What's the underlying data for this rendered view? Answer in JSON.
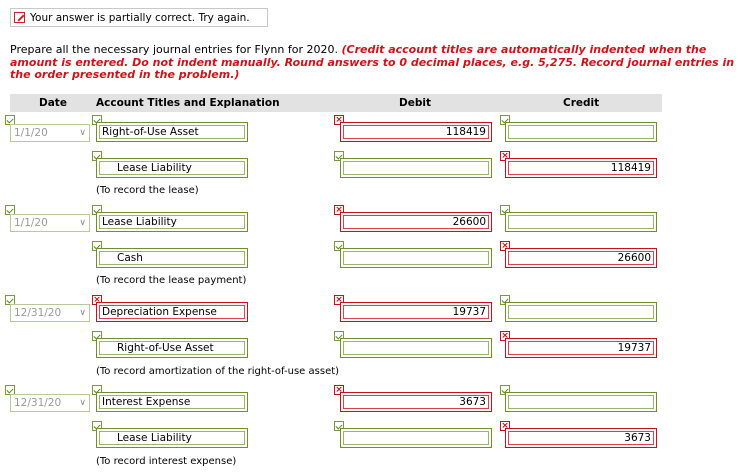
{
  "banner": {
    "text": "Your answer is partially correct.  Try again."
  },
  "instructions": {
    "intro": "Prepare all the necessary journal entries for Flynn for 2020.",
    "note": "(Credit account titles are automatically indented when the amount is entered. Do not indent manually. Round answers to 0 decimal places, e.g. 5,275. Record journal entries in the order presented in the problem.)"
  },
  "table_header": {
    "date": "Date",
    "account": "Account Titles and Explanation",
    "debit": "Debit",
    "credit": "Credit"
  },
  "entries": [
    {
      "date": "1/1/20",
      "debit_line": {
        "account": "Right-of-Use Asset",
        "debit": "118419",
        "credit": ""
      },
      "credit_line": {
        "account": "Lease Liability",
        "debit": "",
        "credit": "118419"
      },
      "note": "(To record the lease)"
    },
    {
      "date": "1/1/20",
      "debit_line": {
        "account": "Lease Liability",
        "debit": "26600",
        "credit": ""
      },
      "credit_line": {
        "account": "Cash",
        "debit": "",
        "credit": "26600"
      },
      "note": "(To record the lease payment)"
    },
    {
      "date": "12/31/20",
      "debit_line": {
        "account": "Depreciation Expense",
        "debit": "19737",
        "credit": ""
      },
      "credit_line": {
        "account": "Right-of-Use Asset",
        "debit": "",
        "credit": "19737"
      },
      "note": "(To record amortization of the right-of-use asset)"
    },
    {
      "date": "12/31/20",
      "debit_line": {
        "account": "Interest Expense",
        "debit": "3673",
        "credit": ""
      },
      "credit_line": {
        "account": "Lease Liability",
        "debit": "",
        "credit": "3673"
      },
      "note": "(To record interest expense)"
    }
  ],
  "colors": {
    "correct": "#6f8f2c",
    "incorrect": "#c8101a",
    "note_red": "#d0121a",
    "header_bg": "#e2e2e2"
  }
}
